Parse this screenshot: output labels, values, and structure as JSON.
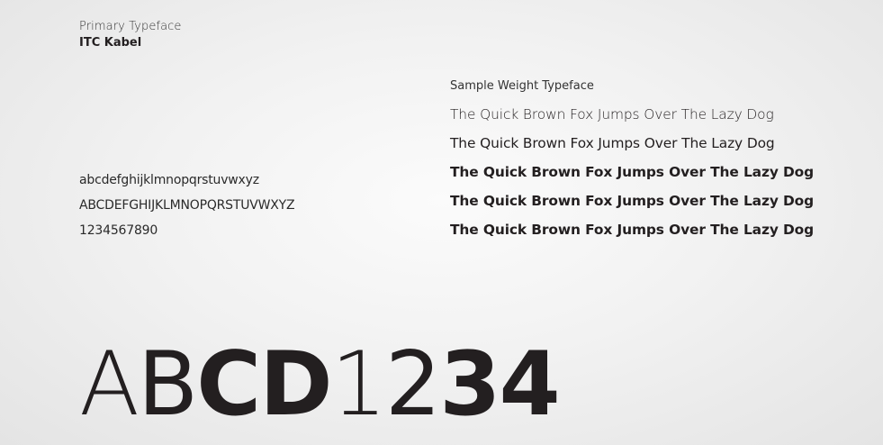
{
  "header": {
    "label": "Primary Typeface",
    "typeface_name": "ITC Kabel"
  },
  "character_set": {
    "lowercase": "abcdefghijklmnopqrstuvwxyz",
    "uppercase": "ABCDEFGHIJKLMNOPQRSTUVWXYZ",
    "digits": "1234567890"
  },
  "sample_weights": {
    "label": "Sample Weight Typeface",
    "lines": [
      "The Quick Brown Fox Jumps Over The Lazy Dog",
      "The Quick Brown Fox Jumps Over The Lazy Dog",
      "The Quick Brown Fox Jumps Over The Lazy Dog",
      "The Quick Brown Fox Jumps Over The Lazy Dog",
      "The Quick Brown Fox Jumps Over The Lazy Dog"
    ]
  },
  "display_glyphs": [
    "A",
    "B",
    "C",
    "D",
    "1",
    "2",
    "3",
    "4"
  ],
  "colors": {
    "text": "#231f20",
    "background": "#f2f2f2"
  }
}
